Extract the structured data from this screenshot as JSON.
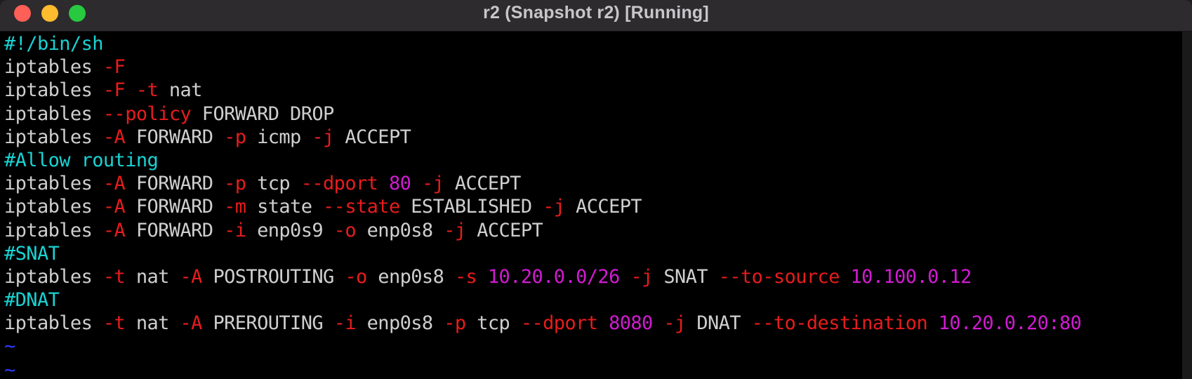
{
  "window": {
    "title": "r2 (Snapshot r2) [Running]",
    "controls": [
      "close",
      "minimize",
      "zoom"
    ]
  },
  "colors": {
    "comment": "#19d3d3",
    "option": "#e81c1c",
    "number": "#d21ad2",
    "text": "#cfcfcf",
    "tilde": "#2a3cff"
  },
  "terminal": {
    "lines": [
      [
        {
          "t": "#!/bin/sh",
          "c": "comment"
        }
      ],
      [
        {
          "t": "iptables ",
          "c": "plain"
        },
        {
          "t": "-F",
          "c": "opt"
        }
      ],
      [
        {
          "t": "iptables ",
          "c": "plain"
        },
        {
          "t": "-F",
          "c": "opt"
        },
        {
          "t": " ",
          "c": "plain"
        },
        {
          "t": "-t",
          "c": "opt"
        },
        {
          "t": " nat",
          "c": "plain"
        }
      ],
      [
        {
          "t": "iptables ",
          "c": "plain"
        },
        {
          "t": "--policy",
          "c": "opt"
        },
        {
          "t": " FORWARD DROP",
          "c": "plain"
        }
      ],
      [
        {
          "t": "iptables ",
          "c": "plain"
        },
        {
          "t": "-A",
          "c": "opt"
        },
        {
          "t": " FORWARD ",
          "c": "plain"
        },
        {
          "t": "-p",
          "c": "opt"
        },
        {
          "t": " icmp ",
          "c": "plain"
        },
        {
          "t": "-j",
          "c": "opt"
        },
        {
          "t": " ACCEPT",
          "c": "plain"
        }
      ],
      [
        {
          "t": "#Allow routing",
          "c": "comment"
        }
      ],
      [
        {
          "t": "iptables ",
          "c": "plain"
        },
        {
          "t": "-A",
          "c": "opt"
        },
        {
          "t": " FORWARD ",
          "c": "plain"
        },
        {
          "t": "-p",
          "c": "opt"
        },
        {
          "t": " tcp ",
          "c": "plain"
        },
        {
          "t": "--dport",
          "c": "opt"
        },
        {
          "t": " ",
          "c": "plain"
        },
        {
          "t": "80",
          "c": "num"
        },
        {
          "t": " ",
          "c": "plain"
        },
        {
          "t": "-j",
          "c": "opt"
        },
        {
          "t": " ACCEPT",
          "c": "plain"
        }
      ],
      [
        {
          "t": "iptables ",
          "c": "plain"
        },
        {
          "t": "-A",
          "c": "opt"
        },
        {
          "t": " FORWARD ",
          "c": "plain"
        },
        {
          "t": "-m",
          "c": "opt"
        },
        {
          "t": " state ",
          "c": "plain"
        },
        {
          "t": "--state",
          "c": "opt"
        },
        {
          "t": " ESTABLISHED ",
          "c": "plain"
        },
        {
          "t": "-j",
          "c": "opt"
        },
        {
          "t": " ACCEPT",
          "c": "plain"
        }
      ],
      [
        {
          "t": "iptables ",
          "c": "plain"
        },
        {
          "t": "-A",
          "c": "opt"
        },
        {
          "t": " FORWARD ",
          "c": "plain"
        },
        {
          "t": "-i",
          "c": "opt"
        },
        {
          "t": " enp0s9 ",
          "c": "plain"
        },
        {
          "t": "-o",
          "c": "opt"
        },
        {
          "t": " enp0s8 ",
          "c": "plain"
        },
        {
          "t": "-j",
          "c": "opt"
        },
        {
          "t": " ACCEPT",
          "c": "plain"
        }
      ],
      [
        {
          "t": "#SNAT",
          "c": "comment"
        }
      ],
      [
        {
          "t": "iptables ",
          "c": "plain"
        },
        {
          "t": "-t",
          "c": "opt"
        },
        {
          "t": " nat ",
          "c": "plain"
        },
        {
          "t": "-A",
          "c": "opt"
        },
        {
          "t": " POSTROUTING ",
          "c": "plain"
        },
        {
          "t": "-o",
          "c": "opt"
        },
        {
          "t": " enp0s8 ",
          "c": "plain"
        },
        {
          "t": "-s",
          "c": "opt"
        },
        {
          "t": " ",
          "c": "plain"
        },
        {
          "t": "10.20.0.0/26",
          "c": "num"
        },
        {
          "t": " ",
          "c": "plain"
        },
        {
          "t": "-j",
          "c": "opt"
        },
        {
          "t": " SNAT ",
          "c": "plain"
        },
        {
          "t": "--to-source",
          "c": "opt"
        },
        {
          "t": " ",
          "c": "plain"
        },
        {
          "t": "10.100.0.12",
          "c": "num"
        }
      ],
      [
        {
          "t": "#DNAT",
          "c": "comment"
        }
      ],
      [
        {
          "t": "iptables ",
          "c": "plain"
        },
        {
          "t": "-t",
          "c": "opt"
        },
        {
          "t": " nat ",
          "c": "plain"
        },
        {
          "t": "-A",
          "c": "opt"
        },
        {
          "t": " PREROUTING ",
          "c": "plain"
        },
        {
          "t": "-i",
          "c": "opt"
        },
        {
          "t": " enp0s8 ",
          "c": "plain"
        },
        {
          "t": "-p",
          "c": "opt"
        },
        {
          "t": " tcp ",
          "c": "plain"
        },
        {
          "t": "--dport",
          "c": "opt"
        },
        {
          "t": " ",
          "c": "plain"
        },
        {
          "t": "8080",
          "c": "num"
        },
        {
          "t": " ",
          "c": "plain"
        },
        {
          "t": "-j",
          "c": "opt"
        },
        {
          "t": " DNAT ",
          "c": "plain"
        },
        {
          "t": "--to-destination",
          "c": "opt"
        },
        {
          "t": " ",
          "c": "plain"
        },
        {
          "t": "10.20.0.20:80",
          "c": "num"
        }
      ],
      [
        {
          "t": "~",
          "c": "tilde"
        }
      ],
      [
        {
          "t": "~",
          "c": "tilde"
        }
      ]
    ]
  }
}
